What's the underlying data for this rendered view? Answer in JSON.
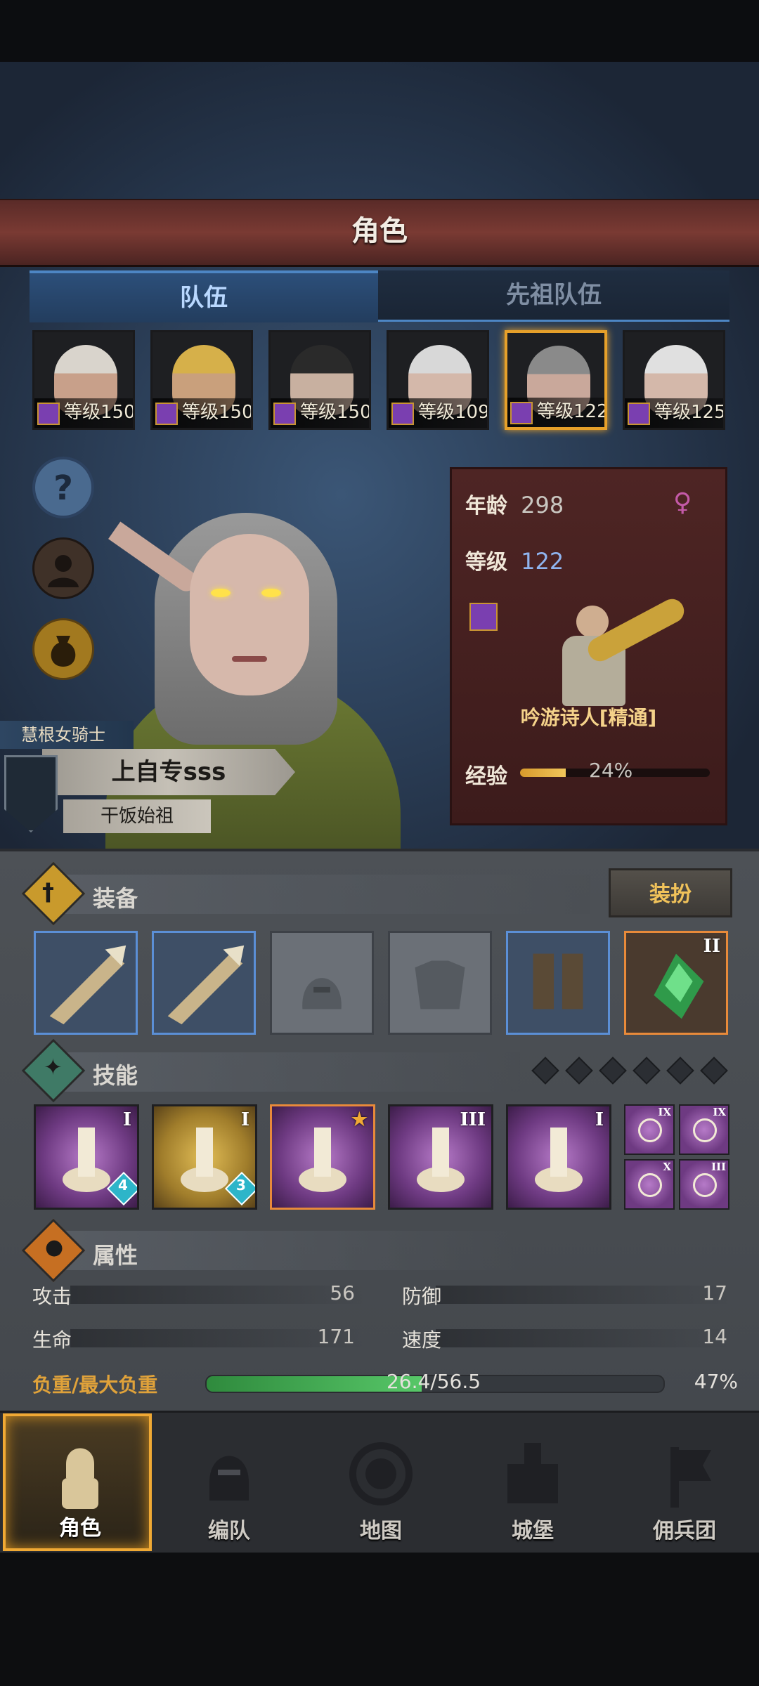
{
  "header": {
    "title": "角色"
  },
  "tabs": [
    {
      "label": "队伍",
      "active": true
    },
    {
      "label": "先祖队伍",
      "active": false
    }
  ],
  "roster": [
    {
      "level_text": "等级150",
      "class_icon": "staff-icon",
      "selected": false,
      "hair": "#d9d4cc",
      "skin": "#c8a08a"
    },
    {
      "level_text": "等级150",
      "class_icon": "horse-icon",
      "selected": false,
      "hair": "#d6b04a",
      "skin": "#c9a07c"
    },
    {
      "level_text": "等级150",
      "class_icon": "shield-icon",
      "selected": false,
      "hair": "#2a2a2a",
      "skin": "#c8b0a0"
    },
    {
      "level_text": "等级109",
      "class_icon": "swords-icon",
      "selected": false,
      "hair": "#d8d8d8",
      "skin": "#d4b8aa"
    },
    {
      "level_text": "等级122",
      "class_icon": "staff-icon",
      "selected": true,
      "hair": "#8a8a8a",
      "skin": "#c9a89b"
    },
    {
      "level_text": "等级125",
      "class_icon": "staff-icon",
      "selected": false,
      "hair": "#e0e0e0",
      "skin": "#d4b8aa"
    }
  ],
  "character": {
    "title": "慧根女骑士",
    "name": "上自专sss",
    "subtitle": "干饭始祖"
  },
  "info": {
    "age_label": "年龄",
    "age_value": "298",
    "gender_icon": "female-icon",
    "level_label": "等级",
    "level_value": "122",
    "job_name": "吟游诗人[精通]",
    "exp_label": "经验",
    "exp_percent_text": "24%",
    "exp_fraction": 0.24
  },
  "equipment": {
    "title": "装备",
    "dress_button": "装扮",
    "slots": [
      {
        "item": "weapon",
        "rarity": "blue"
      },
      {
        "item": "weapon",
        "rarity": "blue"
      },
      {
        "item": "helmet",
        "rarity": "empty"
      },
      {
        "item": "armor",
        "rarity": "empty"
      },
      {
        "item": "boots",
        "rarity": "blue"
      },
      {
        "item": "gem",
        "rarity": "orange",
        "tier": "II"
      }
    ]
  },
  "skills": {
    "title": "技能",
    "big": [
      {
        "icon": "music-note-icon",
        "tier": "I",
        "badge": "4",
        "color": "purple"
      },
      {
        "icon": "heal-shield-icon",
        "tier": "I",
        "badge": "3",
        "color": "gold"
      },
      {
        "icon": "crystal-note-icon",
        "tier": "",
        "badge": "",
        "color": "purple",
        "starred": true
      },
      {
        "icon": "crystal-hand-icon",
        "tier": "III",
        "badge": "",
        "color": "purple"
      },
      {
        "icon": "crystal-person-icon",
        "tier": "I",
        "badge": "",
        "color": "purple"
      }
    ],
    "small": [
      {
        "icon": "sword-icon",
        "tier": "IX"
      },
      {
        "icon": "target-icon",
        "tier": "IX"
      },
      {
        "icon": "burst-icon",
        "tier": "X"
      },
      {
        "icon": "shield-icon",
        "tier": "III"
      }
    ]
  },
  "attributes": {
    "title": "属性",
    "attack_label": "攻击",
    "attack_value": "56",
    "defense_label": "防御",
    "defense_value": "17",
    "hp_label": "生命",
    "hp_value": "171",
    "speed_label": "速度",
    "speed_value": "14",
    "load_label": "负重/最大负重",
    "load_text": "26.4/56.5",
    "load_percent_text": "47%",
    "load_fraction": 0.47
  },
  "nav": [
    {
      "label": "角色",
      "icon": "knight-icon",
      "active": true
    },
    {
      "label": "编队",
      "icon": "helmet-icon",
      "active": false
    },
    {
      "label": "地图",
      "icon": "compass-icon",
      "active": false
    },
    {
      "label": "城堡",
      "icon": "castle-icon",
      "active": false
    },
    {
      "label": "佣兵团",
      "icon": "banner-icon",
      "active": false
    }
  ],
  "colors": {
    "accent_gold": "#f0a934",
    "tab_blue": "#4d86c4",
    "exp_fill": "#f1c65a",
    "load_fill": "#57c768"
  }
}
